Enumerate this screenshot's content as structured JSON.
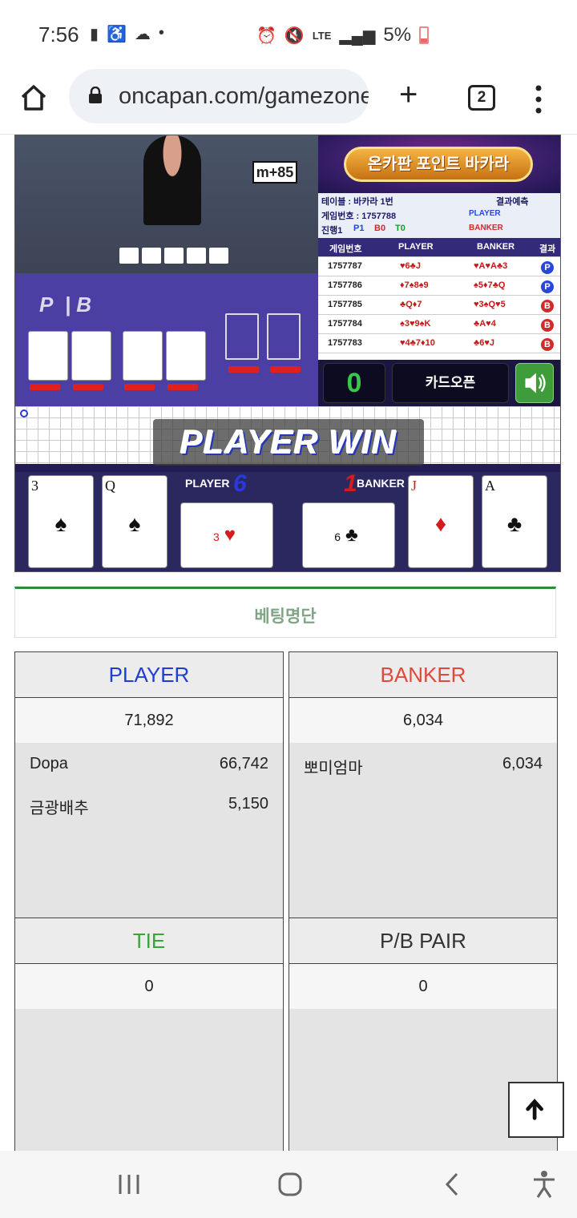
{
  "status_bar": {
    "time": "7:56",
    "battery": "5%"
  },
  "browser": {
    "url": "oncapan.com/gamezone",
    "tab_count": "2"
  },
  "game": {
    "banner_title": "온카판 포인트 바카라",
    "table_label": "테이블 : 바카라 1번",
    "result_label": "결과예측",
    "game_number_label": "게임번호 : 1757788",
    "progress_label": "진행1",
    "progress_p": "P1",
    "progress_b": "B0",
    "progress_t": "T0",
    "predict_player": "PLAYER",
    "predict_banker": "BANKER",
    "video_sign": "m+85",
    "history": {
      "headers": [
        "게임번호",
        "PLAYER",
        "BANKER",
        "결과"
      ],
      "rows": [
        {
          "id": "1757787",
          "player": "♥6♣J",
          "banker": "♥A♥A♣3",
          "result": "P"
        },
        {
          "id": "1757786",
          "player": "♦7♠8♠9",
          "banker": "♠5♦7♣Q",
          "result": "P"
        },
        {
          "id": "1757785",
          "player": "♣Q♦7",
          "banker": "♥3♠Q♥5",
          "result": "B"
        },
        {
          "id": "1757784",
          "player": "♠3♥9♠K",
          "banker": "♣A♥4",
          "result": "B"
        },
        {
          "id": "1757783",
          "player": "♥4♣7♦10",
          "banker": "♣6♥J",
          "result": "B"
        }
      ]
    },
    "timer": "0",
    "card_open_button": "카드오픈",
    "win_banner": "PLAYER WIN",
    "player_label": "PLAYER",
    "player_score": "6",
    "banker_label": "BANKER",
    "banker_score": "1",
    "player_cards": [
      {
        "rank": "3",
        "suit": "♠",
        "color": "#111"
      },
      {
        "rank": "Q",
        "suit": "♠",
        "color": "#111"
      },
      {
        "rank": "3",
        "suit": "♥",
        "color": "#d41c1c"
      }
    ],
    "banker_cards": [
      {
        "rank": "6",
        "suit": "♣",
        "color": "#111"
      },
      {
        "rank": "J",
        "suit": "♦",
        "color": "#d41c1c"
      },
      {
        "rank": "A",
        "suit": "♣",
        "color": "#111"
      }
    ]
  },
  "betting": {
    "tab_title": "베팅명단",
    "player": {
      "title": "PLAYER",
      "total": "71,892",
      "color": "#1d3fd1",
      "entries": [
        {
          "name": "Dopa",
          "amount": "66,742"
        },
        {
          "name": "금광배추",
          "amount": "5,150"
        }
      ]
    },
    "banker": {
      "title": "BANKER",
      "total": "6,034",
      "color": "#de4a3a",
      "entries": [
        {
          "name": "뽀미엄마",
          "amount": "6,034"
        }
      ]
    },
    "tie": {
      "title": "TIE",
      "total": "0",
      "color": "#3aa43a"
    },
    "pair": {
      "title": "P/B PAIR",
      "total": "0",
      "color": "#333"
    }
  }
}
